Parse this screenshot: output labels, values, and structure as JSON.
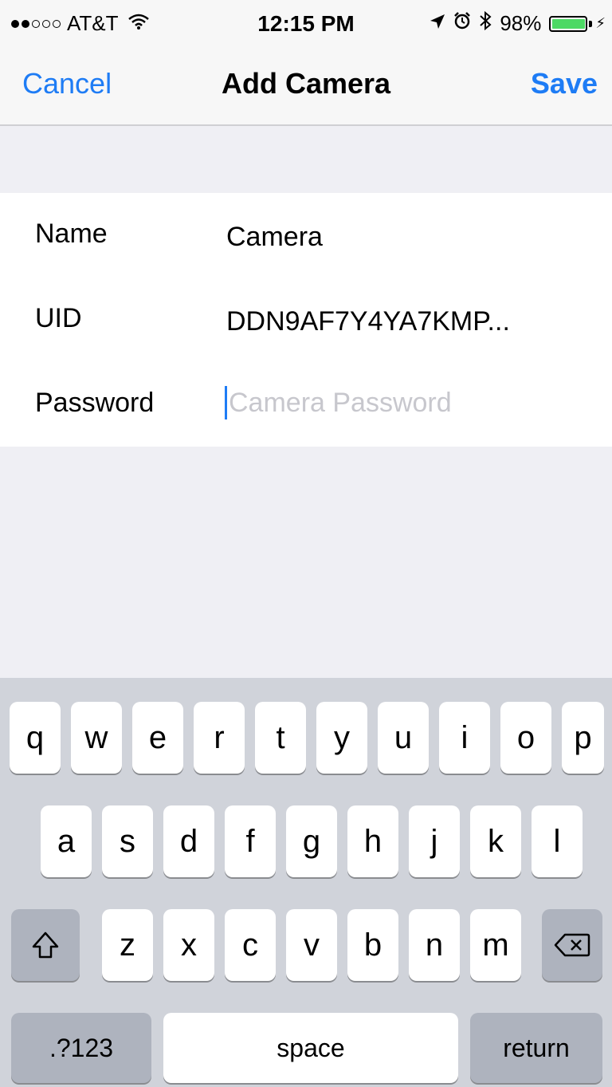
{
  "status_bar": {
    "carrier": "AT&T",
    "time": "12:15 PM",
    "battery_percent": "98%",
    "signal_bars_filled": 2,
    "signal_bars_total": 5,
    "battery_level": 0.98,
    "icons": [
      "wifi-icon",
      "location-arrow-icon",
      "alarm-icon",
      "bluetooth-icon",
      "battery-icon",
      "charging-bolt-icon"
    ]
  },
  "nav": {
    "cancel_label": "Cancel",
    "title": "Add Camera",
    "save_label": "Save"
  },
  "form": {
    "name_label": "Name",
    "name_value": "Camera",
    "uid_label": "UID",
    "uid_value": "DDN9AF7Y4YA7KMP...",
    "password_label": "Password",
    "password_placeholder": "Camera Password",
    "password_value": ""
  },
  "keyboard": {
    "row1": [
      "q",
      "w",
      "e",
      "r",
      "t",
      "y",
      "u",
      "i",
      "o",
      "p"
    ],
    "row2": [
      "a",
      "s",
      "d",
      "f",
      "g",
      "h",
      "j",
      "k",
      "l"
    ],
    "row3": [
      "z",
      "x",
      "c",
      "v",
      "b",
      "n",
      "m"
    ],
    "shift_symbol": "⇧",
    "delete_symbol": "⌫",
    "numbers_label": ".?123",
    "space_label": "space",
    "return_label": "return"
  },
  "colors": {
    "accent": "#1e7cf5",
    "background": "#efeff4",
    "keyboard_bg": "#d0d3da",
    "battery_fill": "#4cd964"
  }
}
